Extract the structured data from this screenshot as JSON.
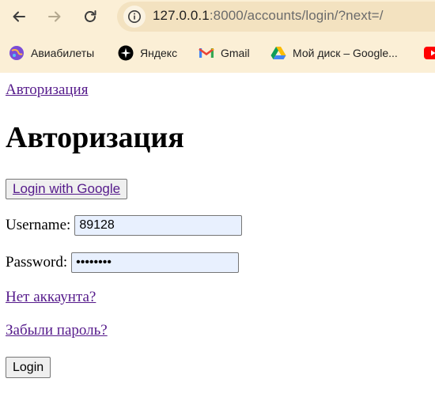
{
  "browser": {
    "url_host": "127.0.0.1",
    "url_rest": ":8000/accounts/login/?next=/",
    "bookmarks": [
      {
        "label": "Авиабилеты",
        "icon": "planet-icon"
      },
      {
        "label": "Яндекс",
        "icon": "yandex-star-icon"
      },
      {
        "label": "Gmail",
        "icon": "gmail-icon"
      },
      {
        "label": "Мой диск – Google...",
        "icon": "google-drive-icon"
      },
      {
        "label": "",
        "icon": "youtube-icon"
      }
    ],
    "colors": {
      "chrome_bg": "#fbefd6",
      "omnibox_bg": "#f3e2c0"
    }
  },
  "page": {
    "top_link": "Авторизация",
    "heading": "Авторизация",
    "google_button": "Login with Google",
    "username_label": "Username:",
    "username_value": "89128",
    "password_label": "Password:",
    "password_value": "••••••••",
    "no_account_link": "Нет аккаунта?",
    "forgot_link": "Забыли пароль?",
    "login_button": "Login",
    "colors": {
      "link": "#551a8b",
      "autofill_bg": "#e8f0fe"
    }
  }
}
